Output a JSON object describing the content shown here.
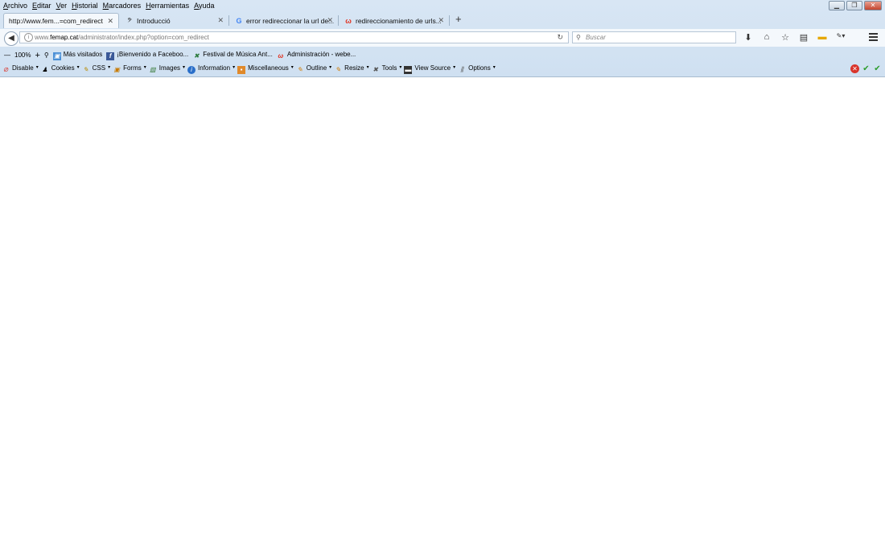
{
  "menu": [
    "Archivo",
    "Editar",
    "Ver",
    "Historial",
    "Marcadores",
    "Herramientas",
    "Ayuda"
  ],
  "window_controls": [
    "minimize-icon",
    "restore-icon",
    "close-icon"
  ],
  "tabs": [
    {
      "label": "http://www.fem...=com_redirect",
      "icon": "none",
      "active": true
    },
    {
      "label": "Introducció",
      "icon": "music-clef-icon",
      "active": false
    },
    {
      "label": "error redireccionar la url de...",
      "icon": "google-icon",
      "active": false
    },
    {
      "label": "redireccionamiento de urls...",
      "icon": "w-icon",
      "active": false
    }
  ],
  "address": {
    "prefix": "www.",
    "domain": "femap.cat",
    "path": "/administrator/index.php?option=com_redirect"
  },
  "search": {
    "placeholder": "Buscar"
  },
  "bookmarks": {
    "zoom": "100%",
    "items": [
      "Más visitados",
      "¡Bienvenido a Faceboo...",
      "Festival de Música Ant...",
      "Administración - webe..."
    ]
  },
  "devtoolbar": [
    "Disable",
    "Cookies",
    "CSS",
    "Forms",
    "Images",
    "Information",
    "Miscellaneous",
    "Outline",
    "Resize",
    "Tools",
    "View Source",
    "Options"
  ],
  "colors": {
    "chrome": "#d6e5f3",
    "accent_red": "#d9342b",
    "accent_green": "#2e9e2e"
  }
}
